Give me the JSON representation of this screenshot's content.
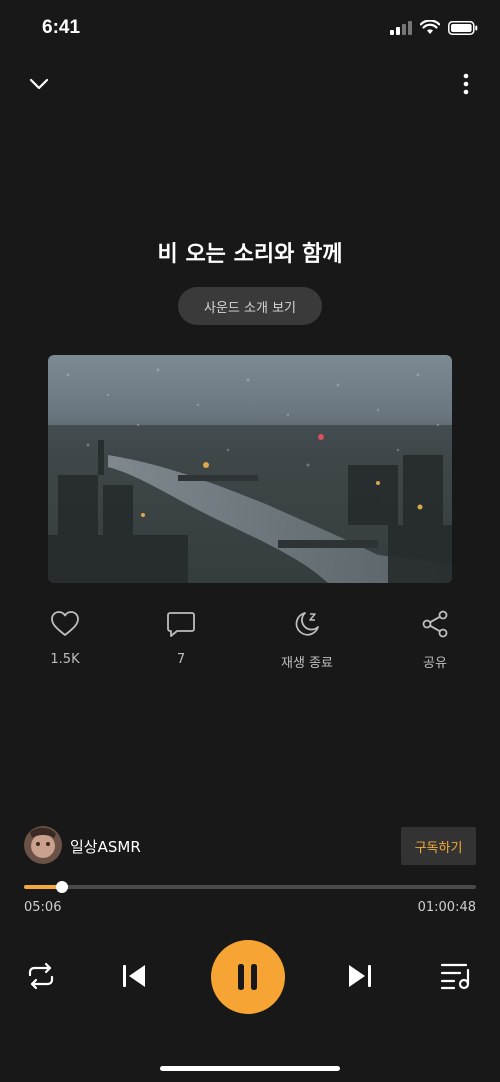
{
  "status": {
    "time": "6:41"
  },
  "header": {
    "title": "비 오는 소리와 함께",
    "intro_button": "사운드 소개 보기"
  },
  "actions": [
    {
      "label": "1.5K",
      "icon": "heart-icon"
    },
    {
      "label": "7",
      "icon": "comment-icon"
    },
    {
      "label": "재생 종료",
      "icon": "sleep-timer-icon"
    },
    {
      "label": "공유",
      "icon": "share-icon"
    }
  ],
  "channel": {
    "name": "일상ASMR",
    "subscribe_label": "구독하기"
  },
  "player": {
    "current_time": "05:06",
    "total_time": "01:00:48",
    "progress": 0.084,
    "accent": "#f4a93a"
  }
}
